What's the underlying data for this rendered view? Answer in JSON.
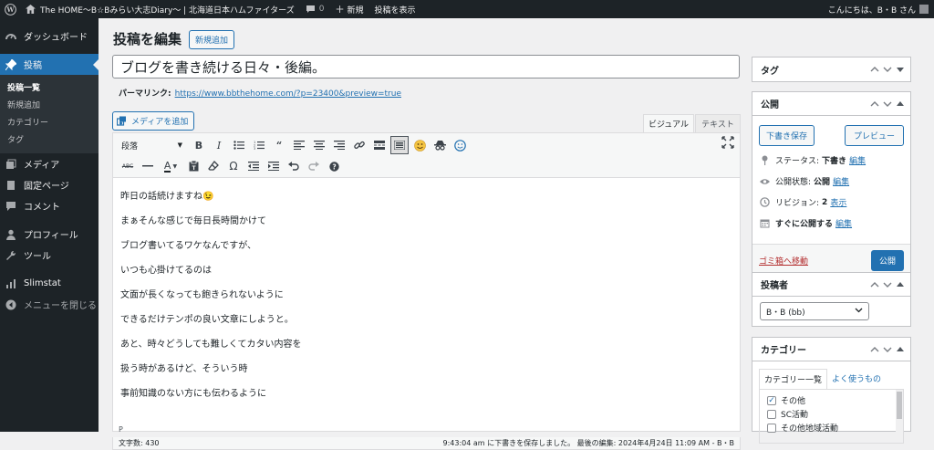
{
  "adminbar": {
    "site_title": "The HOME～B☆Bみらい大志Diary～ | 北海道日本ハムファイターズ",
    "comments_count": "0",
    "new_label": "新規",
    "view_post_label": "投稿を表示",
    "greeting": "こんにちは、B・B さん"
  },
  "sidebar": {
    "dashboard": "ダッシュボード",
    "posts": "投稿",
    "sub_all_posts": "投稿一覧",
    "sub_add_new": "新規追加",
    "sub_categories": "カテゴリー",
    "sub_tags": "タグ",
    "media": "メディア",
    "pages": "固定ページ",
    "comments": "コメント",
    "profile": "プロフィール",
    "tools": "ツール",
    "slimstat": "Slimstat",
    "collapse": "メニューを閉じる"
  },
  "editor": {
    "page_title": "投稿を編集",
    "add_new_button": "新規追加",
    "post_title": "ブログを書き続ける日々・後編。",
    "permalink_label": "パーマリンク:",
    "permalink_url": "https://www.bbthehome.com/?p=23400&preview=true",
    "add_media_button": "メディアを追加",
    "tab_visual": "ビジュアル",
    "tab_text": "テキスト",
    "format_select": "段落",
    "paragraphs": [
      "昨日の話続けますね😉",
      "まぁそんな感じで毎日長時間かけて",
      "ブログ書いてるワケなんですが、",
      "いつも心掛けてるのは",
      "文面が長くなっても飽きられないように",
      "できるだけテンポの良い文章にしようと。",
      "あと、時々どうしても難しくてカタい内容を",
      "扱う時があるけど、そういう時",
      "事前知識のない方にも伝わるように"
    ],
    "path_indicator": "P",
    "word_count": "文字数: 430",
    "last_saved": "9:43:04 am に下書きを保存しました。 最後の編集: 2024年4月24日 11:09 AM - B・B"
  },
  "tags_box": {
    "title": "タグ"
  },
  "publish_box": {
    "title": "公開",
    "save_draft": "下書き保存",
    "preview": "プレビュー",
    "status_label": "ステータス:",
    "status_value": "下書き",
    "visibility_label": "公開状態:",
    "visibility_value": "公開",
    "revisions_label": "リビジョン:",
    "revisions_value": "2",
    "revisions_link": "表示",
    "publish_now": "すぐに公開する",
    "edit_link": "編集",
    "trash_link": "ゴミ箱へ移動",
    "publish_button": "公開"
  },
  "author_box": {
    "title": "投稿者",
    "selected": "B・B (bb)"
  },
  "category_box": {
    "title": "カテゴリー",
    "tab_all": "カテゴリー一覧",
    "tab_popular": "よく使うもの",
    "items": [
      {
        "label": "その他",
        "checked": true
      },
      {
        "label": "SC活動",
        "checked": false
      },
      {
        "label": "その他地域活動",
        "checked": false
      }
    ]
  },
  "colors": {
    "accent": "#2271b1",
    "admin_dark": "#1d2327",
    "danger": "#b32d2e"
  }
}
